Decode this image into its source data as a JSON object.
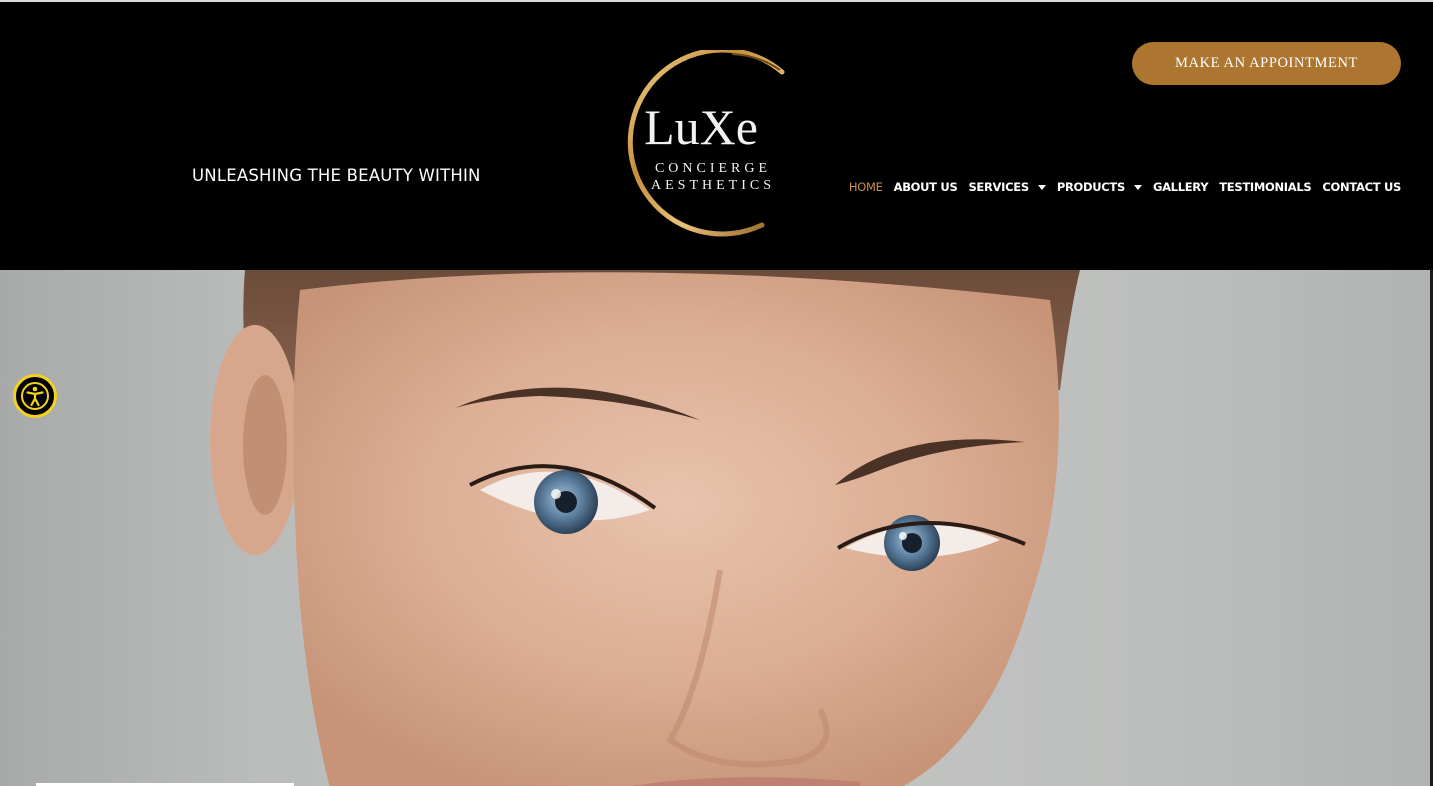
{
  "header": {
    "tagline": "UNLEASHING THE BEAUTY WITHIN",
    "cta_label": "MAKE AN APPOINTMENT",
    "accent_color": "#ac7631"
  },
  "logo": {
    "wordmark": "LuXe",
    "line1": "CONCIERGE",
    "line2": "AESTHETICS"
  },
  "nav": {
    "items": [
      {
        "label": "HOME",
        "active": true,
        "dropdown": false
      },
      {
        "label": "ABOUT US",
        "active": false,
        "dropdown": false
      },
      {
        "label": "SERVICES",
        "active": false,
        "dropdown": true
      },
      {
        "label": "PRODUCTS",
        "active": false,
        "dropdown": true
      },
      {
        "label": "GALLERY",
        "active": false,
        "dropdown": false
      },
      {
        "label": "TESTIMONIALS",
        "active": false,
        "dropdown": false
      },
      {
        "label": "CONTACT US",
        "active": false,
        "dropdown": false
      }
    ],
    "active_color": "#c9924a"
  },
  "hero": {
    "image": "close-up portrait of a woman with blue eyes"
  },
  "widgets": {
    "accessibility_icon": "accessibility-icon",
    "accessibility_ring_color": "#f2d21c"
  }
}
